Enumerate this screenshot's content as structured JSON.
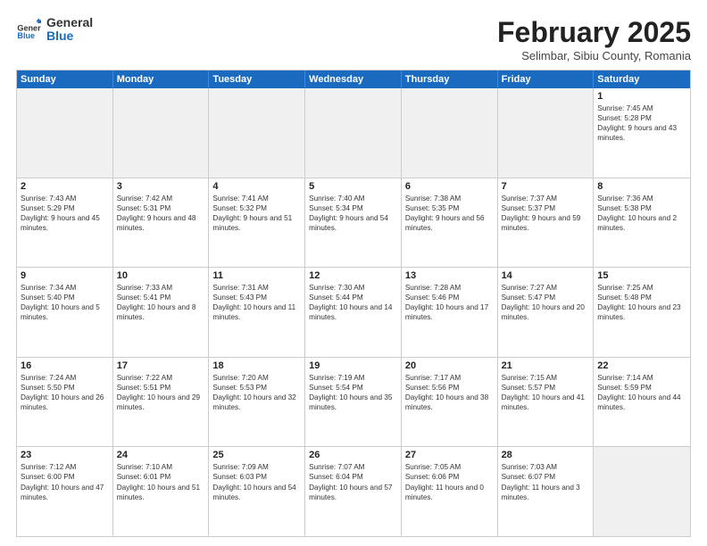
{
  "header": {
    "logo_general": "General",
    "logo_blue": "Blue",
    "month_title": "February 2025",
    "location": "Selimbar, Sibiu County, Romania"
  },
  "weekdays": [
    "Sunday",
    "Monday",
    "Tuesday",
    "Wednesday",
    "Thursday",
    "Friday",
    "Saturday"
  ],
  "rows": [
    [
      {
        "day": "",
        "info": ""
      },
      {
        "day": "",
        "info": ""
      },
      {
        "day": "",
        "info": ""
      },
      {
        "day": "",
        "info": ""
      },
      {
        "day": "",
        "info": ""
      },
      {
        "day": "",
        "info": ""
      },
      {
        "day": "1",
        "info": "Sunrise: 7:45 AM\nSunset: 5:28 PM\nDaylight: 9 hours and 43 minutes."
      }
    ],
    [
      {
        "day": "2",
        "info": "Sunrise: 7:43 AM\nSunset: 5:29 PM\nDaylight: 9 hours and 45 minutes."
      },
      {
        "day": "3",
        "info": "Sunrise: 7:42 AM\nSunset: 5:31 PM\nDaylight: 9 hours and 48 minutes."
      },
      {
        "day": "4",
        "info": "Sunrise: 7:41 AM\nSunset: 5:32 PM\nDaylight: 9 hours and 51 minutes."
      },
      {
        "day": "5",
        "info": "Sunrise: 7:40 AM\nSunset: 5:34 PM\nDaylight: 9 hours and 54 minutes."
      },
      {
        "day": "6",
        "info": "Sunrise: 7:38 AM\nSunset: 5:35 PM\nDaylight: 9 hours and 56 minutes."
      },
      {
        "day": "7",
        "info": "Sunrise: 7:37 AM\nSunset: 5:37 PM\nDaylight: 9 hours and 59 minutes."
      },
      {
        "day": "8",
        "info": "Sunrise: 7:36 AM\nSunset: 5:38 PM\nDaylight: 10 hours and 2 minutes."
      }
    ],
    [
      {
        "day": "9",
        "info": "Sunrise: 7:34 AM\nSunset: 5:40 PM\nDaylight: 10 hours and 5 minutes."
      },
      {
        "day": "10",
        "info": "Sunrise: 7:33 AM\nSunset: 5:41 PM\nDaylight: 10 hours and 8 minutes."
      },
      {
        "day": "11",
        "info": "Sunrise: 7:31 AM\nSunset: 5:43 PM\nDaylight: 10 hours and 11 minutes."
      },
      {
        "day": "12",
        "info": "Sunrise: 7:30 AM\nSunset: 5:44 PM\nDaylight: 10 hours and 14 minutes."
      },
      {
        "day": "13",
        "info": "Sunrise: 7:28 AM\nSunset: 5:46 PM\nDaylight: 10 hours and 17 minutes."
      },
      {
        "day": "14",
        "info": "Sunrise: 7:27 AM\nSunset: 5:47 PM\nDaylight: 10 hours and 20 minutes."
      },
      {
        "day": "15",
        "info": "Sunrise: 7:25 AM\nSunset: 5:48 PM\nDaylight: 10 hours and 23 minutes."
      }
    ],
    [
      {
        "day": "16",
        "info": "Sunrise: 7:24 AM\nSunset: 5:50 PM\nDaylight: 10 hours and 26 minutes."
      },
      {
        "day": "17",
        "info": "Sunrise: 7:22 AM\nSunset: 5:51 PM\nDaylight: 10 hours and 29 minutes."
      },
      {
        "day": "18",
        "info": "Sunrise: 7:20 AM\nSunset: 5:53 PM\nDaylight: 10 hours and 32 minutes."
      },
      {
        "day": "19",
        "info": "Sunrise: 7:19 AM\nSunset: 5:54 PM\nDaylight: 10 hours and 35 minutes."
      },
      {
        "day": "20",
        "info": "Sunrise: 7:17 AM\nSunset: 5:56 PM\nDaylight: 10 hours and 38 minutes."
      },
      {
        "day": "21",
        "info": "Sunrise: 7:15 AM\nSunset: 5:57 PM\nDaylight: 10 hours and 41 minutes."
      },
      {
        "day": "22",
        "info": "Sunrise: 7:14 AM\nSunset: 5:59 PM\nDaylight: 10 hours and 44 minutes."
      }
    ],
    [
      {
        "day": "23",
        "info": "Sunrise: 7:12 AM\nSunset: 6:00 PM\nDaylight: 10 hours and 47 minutes."
      },
      {
        "day": "24",
        "info": "Sunrise: 7:10 AM\nSunset: 6:01 PM\nDaylight: 10 hours and 51 minutes."
      },
      {
        "day": "25",
        "info": "Sunrise: 7:09 AM\nSunset: 6:03 PM\nDaylight: 10 hours and 54 minutes."
      },
      {
        "day": "26",
        "info": "Sunrise: 7:07 AM\nSunset: 6:04 PM\nDaylight: 10 hours and 57 minutes."
      },
      {
        "day": "27",
        "info": "Sunrise: 7:05 AM\nSunset: 6:06 PM\nDaylight: 11 hours and 0 minutes."
      },
      {
        "day": "28",
        "info": "Sunrise: 7:03 AM\nSunset: 6:07 PM\nDaylight: 11 hours and 3 minutes."
      },
      {
        "day": "",
        "info": ""
      }
    ]
  ]
}
